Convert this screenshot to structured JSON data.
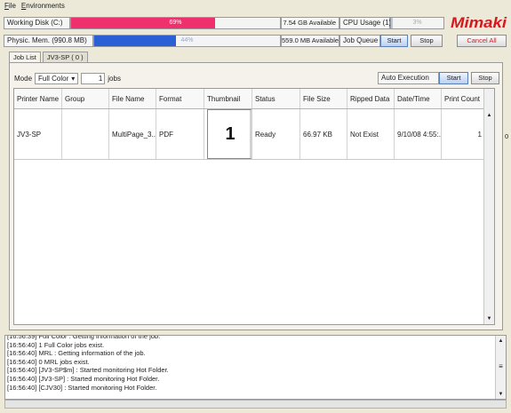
{
  "menu": [
    "File",
    "Environments"
  ],
  "status": {
    "disk_label": "Working Disk (C:)",
    "disk_percent": "69%",
    "disk_fraction": 0.69,
    "disk_available": "7.54 GB Available",
    "cpu_label": "CPU Usage (1)",
    "cpu_percent": "3%",
    "cpu_fraction": 0.03,
    "memory_label": "Physic. Mem. (990.8 MB)",
    "memory_percent": "44%",
    "memory_fraction": 0.44,
    "memory_available": "559.0 MB Available",
    "job_queue_label": "Job Queue",
    "start_label": "Start",
    "stop_label": "Stop",
    "cancel_all_label": "Cancel All"
  },
  "logo": "Mimaki",
  "tabs": [
    {
      "label": "Job List"
    },
    {
      "label": "JV3-SP ( 0 )"
    }
  ],
  "controls": {
    "mode_label": "Mode",
    "mode_value": "Full Color",
    "jobs_count": "1",
    "jobs_label": "jobs",
    "auto_execution_label": "Auto Execution",
    "start_label": "Start",
    "stop_label": "Stop"
  },
  "table": {
    "columns": [
      "Printer Name",
      "Group",
      "File Name",
      "Format",
      "Thumbnail",
      "Status",
      "File Size",
      "Ripped Data",
      "Date/Time",
      "Print Count"
    ],
    "rows": [
      {
        "printer": "JV3-SP",
        "group": "",
        "file": "MultiPage_3...",
        "format": "PDF",
        "thumbnail": "1",
        "status": "Ready",
        "size": "66.97 KB",
        "ripped": "Not Exist",
        "datetime": "9/10/08 4:55:...",
        "count": "1"
      }
    ],
    "extra_count": "0"
  },
  "colors": {
    "disk_bar": "#f0306e",
    "memory_bar": "#2a5fd6",
    "logo_red": "#d6181f"
  },
  "log": [
    "[16:56:39] Full Color : Getting information of the job.",
    "[16:56:40] 1 Full Color jobs exist.",
    "[16:56:40] MRL : Getting information of the job.",
    "[16:56:40] 0 MRL jobs exist.",
    "[16:56:40] [JV3-SP$m] : Started monitoring Hot Folder.",
    "[16:56:40] [JV3-SP] : Started monitoring Hot Folder.",
    "[16:56:40] [CJV30] : Started monitoring Hot Folder."
  ]
}
